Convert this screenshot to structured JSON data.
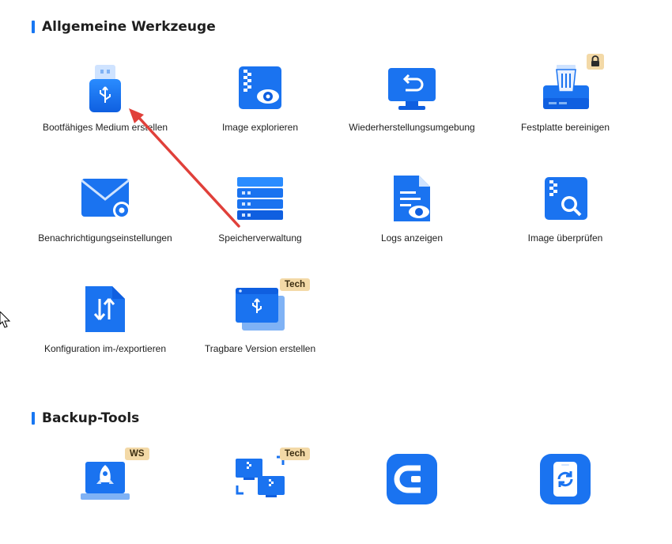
{
  "sections": {
    "general": "Allgemeine Werkzeuge",
    "backup": "Backup-Tools"
  },
  "tools": {
    "boot_media": "Bootfähiges Medium erstellen",
    "image_explore": "Image explorieren",
    "recovery_env": "Wiederherstellungsumgebung",
    "wipe_disk": "Festplatte bereinigen",
    "notify_settings": "Benachrichtigungseinstellungen",
    "storage_mgmt": "Speicherverwaltung",
    "view_logs": "Logs anzeigen",
    "check_image": "Image überprüfen",
    "config_io": "Konfiguration im-/exportieren",
    "portable": "Tragbare Version erstellen"
  },
  "badges": {
    "portable": "Tech",
    "ws": "WS",
    "network": "Tech"
  },
  "colors": {
    "accent": "#1877f2",
    "badge_bg": "#f3d9a7",
    "annotation_arrow": "#e0403a"
  }
}
